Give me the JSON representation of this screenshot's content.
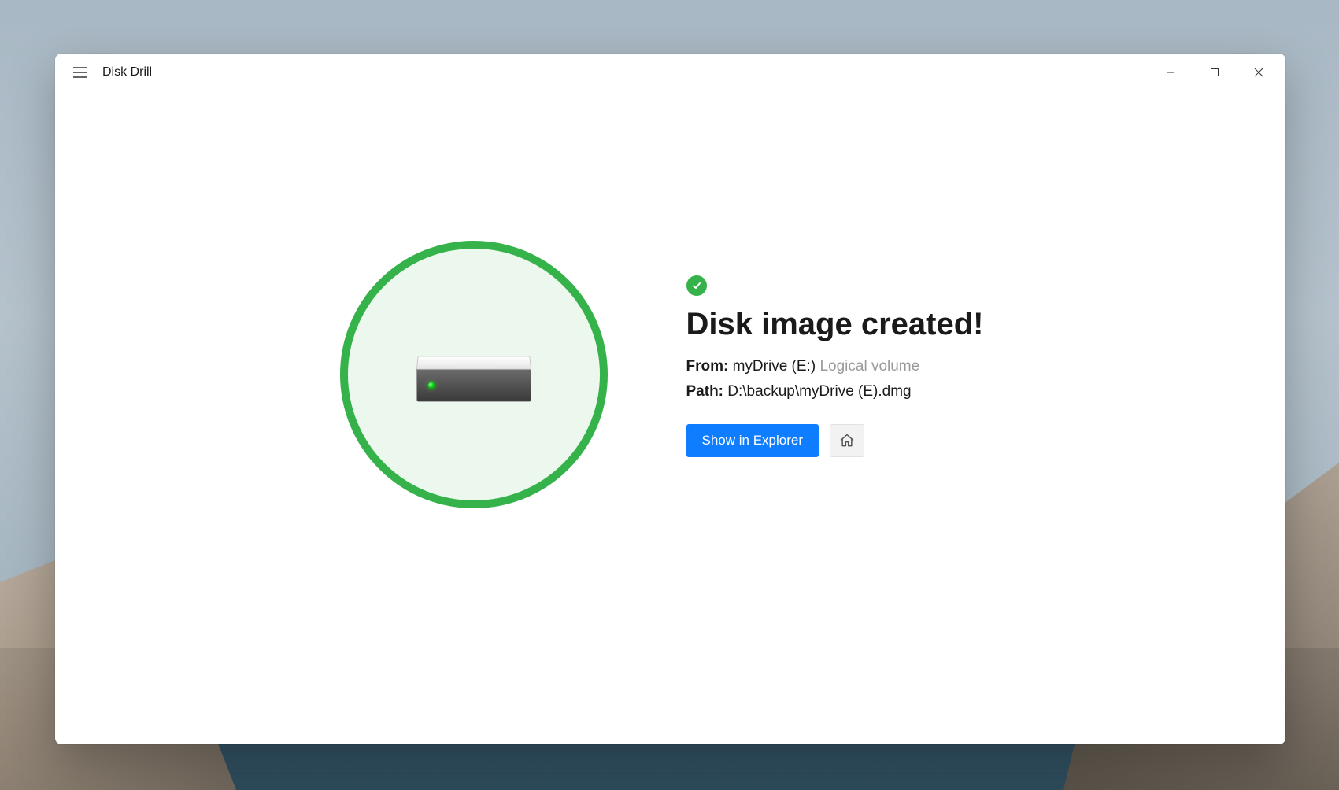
{
  "app": {
    "title": "Disk Drill"
  },
  "result": {
    "heading": "Disk image created!",
    "from_label": "From:",
    "from_value": "myDrive (E:)",
    "from_type": "Logical volume",
    "path_label": "Path:",
    "path_value": "D:\\backup\\myDrive (E).dmg",
    "button_show": "Show in Explorer"
  },
  "colors": {
    "accent": "#0f7dff",
    "success": "#36b24a"
  }
}
